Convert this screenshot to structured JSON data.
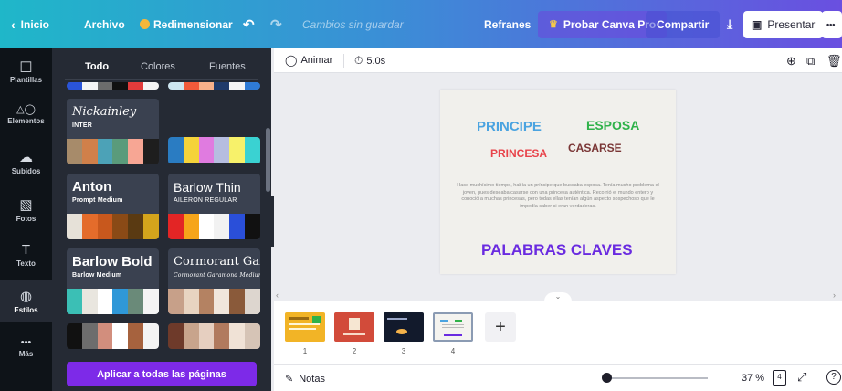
{
  "topbar": {
    "back_label": "Inicio",
    "file_label": "Archivo",
    "resize_label": "Redimensionar",
    "save_status": "Cambios sin guardar",
    "doc_title": "Refranes",
    "pro_label": "Probar Canva Pro",
    "share_label": "Compartir",
    "present_label": "Presentar",
    "more_label": "•••"
  },
  "rail": [
    {
      "icon": "templates-icon",
      "glyph": "◫",
      "label": "Plantillas"
    },
    {
      "icon": "elements-icon",
      "glyph": "△◯",
      "label": "Elementos"
    },
    {
      "icon": "upload-icon",
      "glyph": "☁",
      "label": "Subidos"
    },
    {
      "icon": "photos-icon",
      "glyph": "▧",
      "label": "Fotos"
    },
    {
      "icon": "text-icon",
      "glyph": "T",
      "label": "Texto"
    },
    {
      "icon": "styles-icon",
      "glyph": "◍",
      "label": "Estilos"
    },
    {
      "icon": "more-icon",
      "glyph": "•••",
      "label": "Más"
    }
  ],
  "panel": {
    "tabs": [
      "Todo",
      "Colores",
      "Fuentes"
    ],
    "cards": [
      {
        "title": "Nickainley",
        "subtitle": "INTER",
        "palette": [
          "#a78b6a",
          "#d0804a",
          "#4ca2b7",
          "#5a9b7b",
          "#f7a694",
          "#1e1e1e"
        ]
      },
      {
        "title": "",
        "subtitle": "",
        "palette": [
          "#2a7cc2",
          "#f5d33a",
          "#e07be0",
          "#b6bde0",
          "#f7f16a",
          "#3ad2d2"
        ]
      },
      {
        "title": "Anton",
        "subtitle": "Prompt Medium",
        "palette": [
          "#e6e1d8",
          "#e46c2b",
          "#c8581d",
          "#8a4a16",
          "#5a3a12",
          "#d4a41c"
        ]
      },
      {
        "title": "Barlow Thin",
        "subtitle": "AILERON REGULAR",
        "palette": [
          "#e32525",
          "#f6a51a",
          "#ffffff",
          "#f2f2f2",
          "#2a4fd9",
          "#111111"
        ]
      },
      {
        "title": "Barlow Bold",
        "subtitle": "Barlow Medium",
        "palette": [
          "#3bbfb5",
          "#e9e6df",
          "#ffffff",
          "#2f98d8",
          "#6a8a79",
          "#f4f4f4"
        ]
      },
      {
        "title": "Cormorant Gar",
        "subtitle": "Cormorant Garamond Medium",
        "palette": [
          "#c7a089",
          "#e8d4c1",
          "#b48262",
          "#f0e6dc",
          "#8a5a3a",
          "#ddd6cf"
        ]
      },
      {
        "title": "",
        "subtitle": "",
        "palette": [
          "#111111",
          "#6d6d6d",
          "#d28e7d",
          "#ffffff",
          "#a6623e",
          "#f4f4f4"
        ]
      },
      {
        "title": "",
        "subtitle": "",
        "palette": [
          "#6e3a2a",
          "#c8a48c",
          "#e6cfc0",
          "#b17a5e",
          "#f0e2d6",
          "#d6c4b6"
        ]
      }
    ],
    "apply_label": "Aplicar a todas las páginas"
  },
  "toolbar": {
    "animate_label": "Animar",
    "duration": "5.0s"
  },
  "slide": {
    "words": [
      "PRINCIPE",
      "ESPOSA",
      "PRINCESA",
      "CASARSE"
    ],
    "paragraph": "Hace muchísimo tiempo, había un príncipe que buscaba esposa. Tenía mucho problema el joven, pues deseaba casarse con una princesa auténtica. Recorrió el mundo entero y conoció a muchas princesas, pero todas ellas tenían algún aspecto sospechoso que le impedía saber si eran verdaderas.",
    "heading": "PALABRAS CLAVES",
    "colors": {
      "principe": "#4aa3e0",
      "esposa": "#2fb24a",
      "princesa": "#e8434a",
      "casarse": "#7a3636",
      "heading": "#6a2be0"
    }
  },
  "pages": [
    {
      "number": "1"
    },
    {
      "number": "2"
    },
    {
      "number": "3"
    },
    {
      "number": "4"
    }
  ],
  "bottom": {
    "notes_label": "Notas",
    "zoom": "37 %",
    "page_icon_label": "4"
  }
}
